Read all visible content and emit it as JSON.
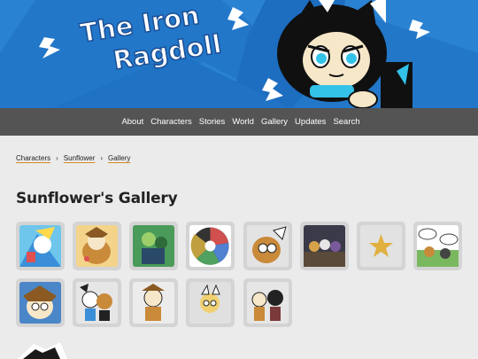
{
  "site": {
    "logo_line1": "The Iron",
    "logo_line2": "Ragdoll"
  },
  "nav": {
    "items": [
      "About",
      "Characters",
      "Stories",
      "World",
      "Gallery",
      "Updates",
      "Search"
    ]
  },
  "breadcrumb": {
    "items": [
      "Characters",
      "Sunflower",
      "Gallery"
    ]
  },
  "page": {
    "title": "Sunflower's Gallery"
  },
  "gallery": {
    "thumbnails": [
      {
        "icon": "blue-character-art"
      },
      {
        "icon": "sunflower-plush-art"
      },
      {
        "icon": "green-group-art"
      },
      {
        "icon": "character-wheel-art"
      },
      {
        "icon": "sunflower-peeking-art"
      },
      {
        "icon": "group-scene-art"
      },
      {
        "icon": "star-art"
      },
      {
        "icon": "comic-panel-art"
      },
      {
        "icon": "sunflower-portrait-art"
      },
      {
        "icon": "two-characters-art"
      },
      {
        "icon": "sunflower-pose-art"
      },
      {
        "icon": "sunflower-chibi-art"
      },
      {
        "icon": "duo-characters-art"
      }
    ]
  },
  "colors": {
    "banner_blue": "#2a82d2",
    "nav_gray": "#545454",
    "accent_orange": "#d48a1f",
    "page_bg": "#ebebeb"
  }
}
